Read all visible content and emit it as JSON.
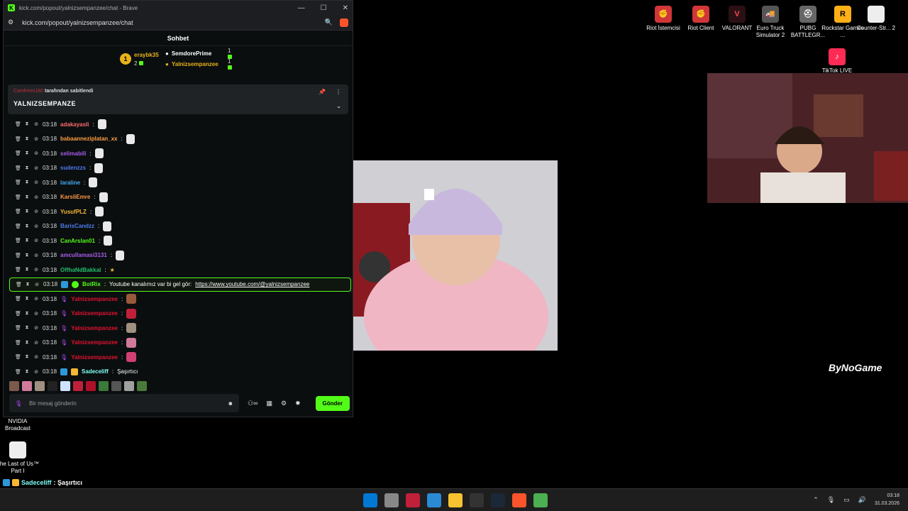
{
  "browser": {
    "title": "kick.com/popout/yalnizsempanzee/chat - Brave",
    "url": "kick.com/popout/yalnizsempanzee/chat"
  },
  "chat": {
    "header": "Sohbet",
    "leaderboard": {
      "top_user": "eraybk35",
      "top_count": "2",
      "rank_badge": "1",
      "rows": [
        {
          "name": "SemdorePrime",
          "count": "1",
          "color": "#ffffff"
        },
        {
          "name": "Yalnizsempanzee",
          "count": "1",
          "color": "#e8b21a"
        }
      ]
    },
    "pinned": {
      "by_user": "Camfrees180",
      "by_suffix": "tarafından sabitlendi",
      "message": "YALNIZSEMPANZE"
    },
    "messages": [
      {
        "time": "03:18",
        "user": "adakayasli",
        "color": "#ff6b6b",
        "text": ""
      },
      {
        "time": "03:18",
        "user": "babaanneziplatan_xx",
        "color": "#ff9f43",
        "text": ""
      },
      {
        "time": "03:18",
        "user": "selimabili",
        "color": "#a55eea",
        "text": ""
      },
      {
        "time": "03:18",
        "user": "sudenzzs",
        "color": "#4b7bec",
        "text": ""
      },
      {
        "time": "03:18",
        "user": "laraline",
        "color": "#45aaf2",
        "text": ""
      },
      {
        "time": "03:18",
        "user": "KarsliEmre",
        "color": "#fd9644",
        "text": ""
      },
      {
        "time": "03:18",
        "user": "YusufPLZ",
        "color": "#f7b731",
        "text": ""
      },
      {
        "time": "03:18",
        "user": "BarisCandzz",
        "color": "#4b7bec",
        "text": ""
      },
      {
        "time": "03:18",
        "user": "CanArslan01",
        "color": "#53fc18",
        "text": ""
      },
      {
        "time": "03:18",
        "user": "amcullamasi3131",
        "color": "#a55eea",
        "text": ""
      },
      {
        "time": "03:18",
        "user": "OffhaNdBakkal",
        "color": "#20bf6b",
        "text": ""
      }
    ],
    "bot_message": {
      "time": "03:18",
      "user": "BotRix",
      "text": "Youtube kanalımız var bi gel gör:",
      "link": "https://www.youtube.com/@yalnizsempanzee"
    },
    "streamer_messages": [
      {
        "time": "03:18",
        "user": "Yalnizsempanzee"
      },
      {
        "time": "03:18",
        "user": "Yalnizsempanzee"
      },
      {
        "time": "03:18",
        "user": "Yalnizsempanzee"
      },
      {
        "time": "03:18",
        "user": "Yalnizsempanzee"
      },
      {
        "time": "03:18",
        "user": "Yalnizsempanzee"
      }
    ],
    "last_message": {
      "time": "03:18",
      "user": "Sadeceliff",
      "text": "Şaşırtıcı"
    },
    "input_placeholder": "Bir mesaj gönderin",
    "send_label": "Gönder"
  },
  "desktop_icons": [
    {
      "label": "Riot İstemcisi",
      "color": "#d13639"
    },
    {
      "label": "Riot Client",
      "color": "#d13639"
    },
    {
      "label": "VALORANT",
      "color": "#fa4454"
    },
    {
      "label": "Euro Truck Simulator 2",
      "color": "#555555"
    },
    {
      "label": "PUBG BATTLEGR...",
      "color": "#666666"
    },
    {
      "label": "Rockstar Games ...",
      "color": "#fcaf17"
    },
    {
      "label": "Counter-Str... 2",
      "color": "#eeeeee"
    },
    {
      "label": "TikTok LIVE",
      "color": "#fe2c55"
    },
    {
      "label": "NVIDIA Broadcast",
      "color": "#76b900"
    },
    {
      "label": "The Last of Us™ Part I",
      "color": "#eeeeee"
    }
  ],
  "watermark": "ByNoGame",
  "overlay": {
    "user": "Sadeceliff",
    "text": ": Şaşırtıcı"
  },
  "taskbar": {
    "time": "03:18",
    "date": "31.03.2026"
  }
}
